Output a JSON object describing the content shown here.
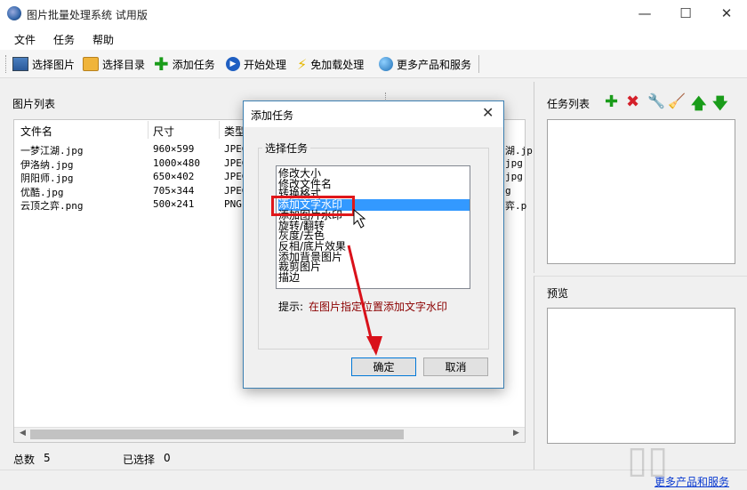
{
  "window": {
    "title": "图片批量处理系统 试用版"
  },
  "menu": [
    "文件",
    "任务",
    "帮助"
  ],
  "toolbar": {
    "select_image": "选择图片",
    "select_dir": "选择目录",
    "add_task": "添加任务",
    "start": "开始处理",
    "free_load": "免加载处理",
    "more": "更多产品和服务"
  },
  "left": {
    "title": "图片列表",
    "columns": [
      "文件名",
      "尺寸",
      "类型"
    ],
    "rows": [
      {
        "name": "一梦江湖.jpg",
        "size": "960×599",
        "type": "JPEG",
        "tail": "湖.jp"
      },
      {
        "name": "伊洛纳.jpg",
        "size": "1000×480",
        "type": "JPEG",
        "tail": "jpg"
      },
      {
        "name": "阴阳师.jpg",
        "size": "650×402",
        "type": "JPEG",
        "tail": "jpg"
      },
      {
        "name": "优酷.jpg",
        "size": "705×344",
        "type": "JPEG",
        "tail": "g"
      },
      {
        "name": "云顶之弈.png",
        "size": "500×241",
        "type": "PNG",
        "tail": "弈.p"
      }
    ]
  },
  "status": {
    "total_label": "总数",
    "total": "5",
    "selected_label": "已选择",
    "selected": "0"
  },
  "right": {
    "task_title": "任务列表",
    "preview_title": "预览"
  },
  "footer_link": "更多产品和服务",
  "dialog": {
    "title": "添加任务",
    "group": "选择任务",
    "options": [
      "修改大小",
      "修改文件名",
      "转换格式",
      "添加文字水印",
      "添加图片水印",
      "旋转/翻转",
      "灰度/去色",
      "反相/底片效果",
      "添加背景图片",
      "裁剪图片",
      "描边"
    ],
    "selected_index": 3,
    "hint_label": "提示:",
    "hint_text": "在图片指定位置添加文字水印",
    "ok": "确定",
    "cancel": "取消"
  },
  "colors": {
    "selection": "#3399ff",
    "annotation": "#e0171a",
    "link": "#0a3ad0"
  }
}
